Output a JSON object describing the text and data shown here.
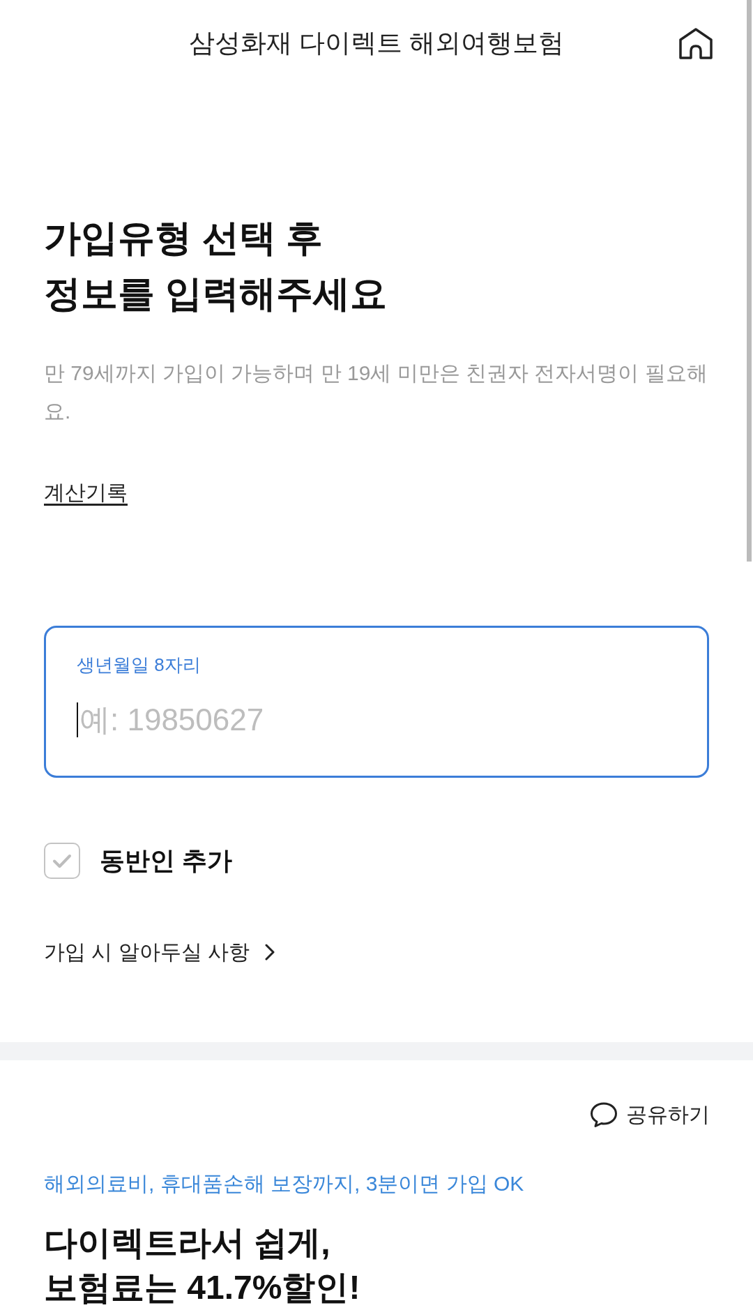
{
  "header": {
    "title": "삼성화재 다이렉트 해외여행보험"
  },
  "intro": {
    "heading_lines": [
      "가입유형 선택 후",
      "정보를 입력해주세요"
    ],
    "description": "만 79세까지 가입이 가능하며 만 19세 미만은 친권자 전자서명이 필요해요.",
    "history_link": "계산기록"
  },
  "birth_field": {
    "label": "생년월일 8자리",
    "placeholder": "예: 19850627",
    "focused": true
  },
  "companion_checkbox": {
    "label": "동반인 추가",
    "checked": false
  },
  "notice_link": {
    "label": "가입 시 알아두실 사항"
  },
  "promo": {
    "share": "공유하기",
    "tagline": "해외의료비, 휴대품손해 보장까지, 3분이면 가입 OK",
    "headline_lines": [
      "다이렉트라서 쉽게,",
      "보험료는 41.7%할인!"
    ]
  }
}
